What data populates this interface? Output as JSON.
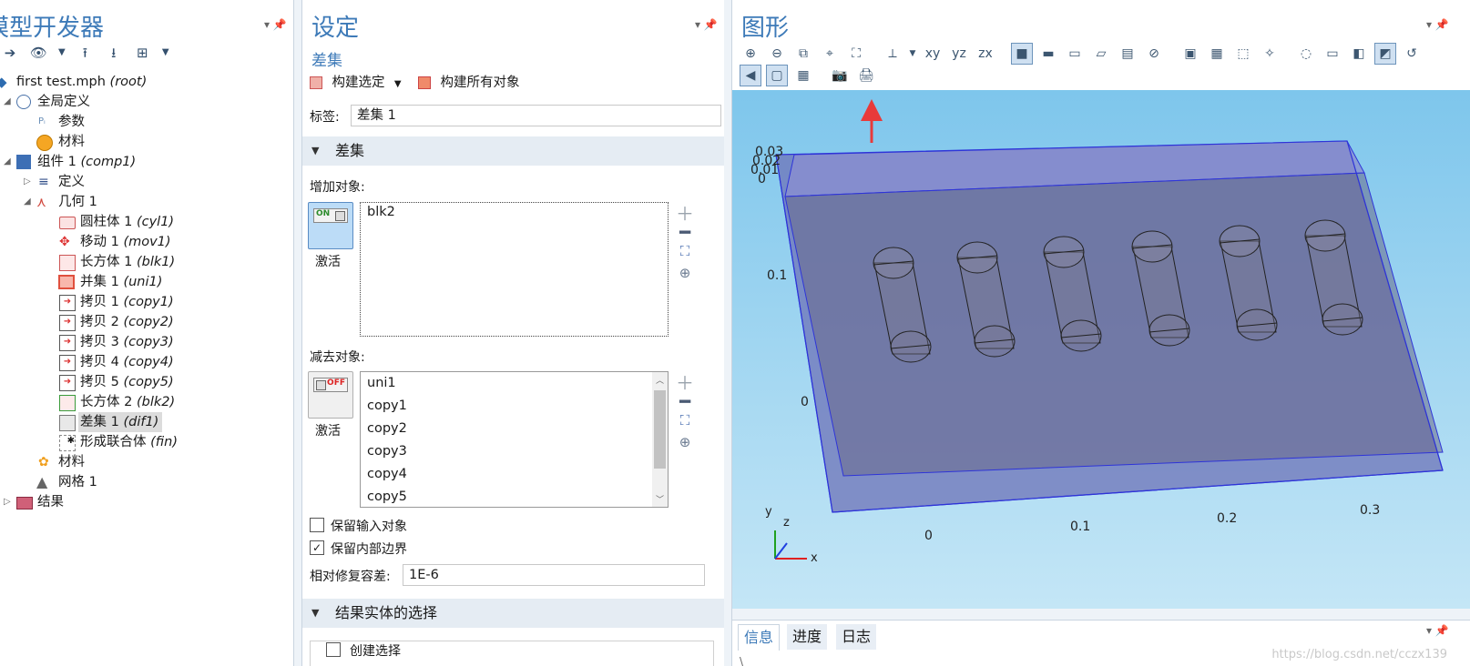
{
  "model_builder": {
    "title": "模型开发器",
    "tree": [
      {
        "label": "first test.mph",
        "tag": "(root)"
      },
      {
        "label": "全局定义",
        "tag": ""
      },
      {
        "label": "参数",
        "tag": ""
      },
      {
        "label": "材料",
        "tag": ""
      },
      {
        "label": "组件 1",
        "tag": "(comp1)"
      },
      {
        "label": "定义",
        "tag": ""
      },
      {
        "label": "几何 1",
        "tag": ""
      },
      {
        "label": "圆柱体 1",
        "tag": "(cyl1)"
      },
      {
        "label": "移动 1",
        "tag": "(mov1)"
      },
      {
        "label": "长方体 1",
        "tag": "(blk1)"
      },
      {
        "label": "并集 1",
        "tag": "(uni1)"
      },
      {
        "label": "拷贝 1",
        "tag": "(copy1)"
      },
      {
        "label": "拷贝 2",
        "tag": "(copy2)"
      },
      {
        "label": "拷贝 3",
        "tag": "(copy3)"
      },
      {
        "label": "拷贝 4",
        "tag": "(copy4)"
      },
      {
        "label": "拷贝 5",
        "tag": "(copy5)"
      },
      {
        "label": "长方体 2",
        "tag": "(blk2)"
      },
      {
        "label": "差集 1",
        "tag": "(dif1)"
      },
      {
        "label": "形成联合体",
        "tag": "(fin)"
      },
      {
        "label": "材料",
        "tag": ""
      },
      {
        "label": "网格 1",
        "tag": ""
      },
      {
        "label": "结果",
        "tag": ""
      }
    ]
  },
  "settings": {
    "title": "设定",
    "subtitle": "差集",
    "build_selected": "构建选定",
    "build_all": "构建所有对象",
    "label_caption": "标签:",
    "label_value": "差集 1",
    "section_difference": "差集",
    "add_objects_caption": "增加对象:",
    "add_objects": [
      "blk2"
    ],
    "add_toggle": {
      "state": "ON",
      "caption": "激活"
    },
    "subtract_objects_caption": "减去对象:",
    "subtract_objects": [
      "uni1",
      "copy1",
      "copy2",
      "copy3",
      "copy4",
      "copy5"
    ],
    "subtract_toggle": {
      "state": "OFF",
      "caption": "激活"
    },
    "keep_input": {
      "label": "保留输入对象",
      "checked": false
    },
    "keep_interior": {
      "label": "保留内部边界",
      "checked": true
    },
    "repair_tol_caption": "相对修复容差:",
    "repair_tol_value": "1E-6",
    "section_result": "结果实体的选择",
    "create_selection": {
      "label": "创建选择",
      "checked": false
    }
  },
  "graphics": {
    "title": "图形",
    "ticks_z": [
      "0.03",
      "0.02",
      "0.01",
      "0"
    ],
    "ticks_y": [
      "0.1",
      "0"
    ],
    "ticks_x": [
      "0",
      "0.1",
      "0.2",
      "0.3"
    ],
    "axis_labels": {
      "x": "x",
      "y": "y",
      "z": "z"
    }
  },
  "bottom_tabs": [
    "信息",
    "进度",
    "日志"
  ],
  "watermark": "https://blog.csdn.net/cczx139",
  "colors": {
    "accent": "#3d7ab8",
    "block_fill": "#7b7fc4",
    "annotation_arrow": "#e83a3a"
  }
}
